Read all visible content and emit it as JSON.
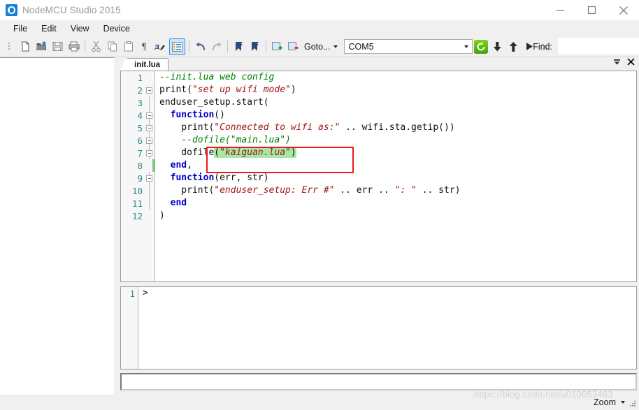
{
  "window": {
    "title": "NodeMCU Studio 2015",
    "app_icon": "nodemcu-logo-icon",
    "minimize_label": "minimize-icon",
    "maximize_label": "maximize-icon",
    "close_label": "close-icon"
  },
  "menubar": {
    "items": [
      {
        "label": "File"
      },
      {
        "label": "Edit"
      },
      {
        "label": "View"
      },
      {
        "label": "Device"
      }
    ]
  },
  "toolbar": {
    "buttons": [
      {
        "name": "new-file-icon",
        "glyph": "new"
      },
      {
        "name": "open-file-icon",
        "glyph": "open"
      },
      {
        "name": "save-file-icon",
        "glyph": "save"
      },
      {
        "name": "print-icon",
        "glyph": "print"
      },
      {
        "name": "cut-icon",
        "glyph": "cut"
      },
      {
        "name": "copy-icon",
        "glyph": "copy"
      },
      {
        "name": "paste-icon",
        "glyph": "paste"
      },
      {
        "name": "pilcrow-icon",
        "glyph": "pilcrow"
      },
      {
        "name": "syntax-icon",
        "glyph": "syntax"
      },
      {
        "name": "list-view-icon",
        "glyph": "list"
      },
      {
        "name": "undo-icon",
        "glyph": "undo"
      },
      {
        "name": "redo-icon",
        "glyph": "redo"
      },
      {
        "name": "bookmark-toggle-icon",
        "glyph": "bookmark"
      },
      {
        "name": "bookmark-next-icon",
        "glyph": "bookmark2"
      },
      {
        "name": "add-file-icon",
        "glyph": "addfile"
      },
      {
        "name": "remove-file-icon",
        "glyph": "removefile"
      }
    ],
    "goto_label": "Goto...",
    "port_value": "COM5",
    "refresh_button": "refresh-port-icon",
    "download_button": "download-icon",
    "upload_button": "upload-icon",
    "run_button": "run-icon",
    "stop_button": "stop-icon",
    "find_label": "Find:",
    "find_value": "",
    "find_placeholder": "",
    "accent_color": "#3c8ede",
    "green_color": "#5fb81b"
  },
  "tabs": {
    "items": [
      {
        "label": "init.lua",
        "active": true
      }
    ],
    "dropdown_icon": "tab-list-icon",
    "close_icon": "close-tab-icon"
  },
  "editor": {
    "language": "lua",
    "lines": [
      {
        "num": "1",
        "fold": false,
        "foldline": false,
        "changed": false,
        "tokens": [
          {
            "t": "--init.lua web config",
            "c": "k-com"
          }
        ]
      },
      {
        "num": "2",
        "fold": true,
        "foldline": false,
        "changed": false,
        "tokens": [
          {
            "t": "print(",
            "c": ""
          },
          {
            "t": "\"set up wifi mode\"",
            "c": "k-str"
          },
          {
            "t": ")",
            "c": ""
          }
        ]
      },
      {
        "num": "3",
        "fold": false,
        "foldline": true,
        "changed": false,
        "tokens": [
          {
            "t": "enduser_setup.start(",
            "c": ""
          }
        ]
      },
      {
        "num": "4",
        "fold": true,
        "foldline": true,
        "changed": false,
        "tokens": [
          {
            "t": "  ",
            "c": ""
          },
          {
            "t": "function",
            "c": "k-kw"
          },
          {
            "t": "()",
            "c": ""
          }
        ]
      },
      {
        "num": "5",
        "fold": true,
        "foldline": true,
        "changed": false,
        "tokens": [
          {
            "t": "    print(",
            "c": ""
          },
          {
            "t": "\"Connected to wifi as:\"",
            "c": "k-str"
          },
          {
            "t": " .. wifi.sta.getip())",
            "c": ""
          }
        ]
      },
      {
        "num": "6",
        "fold": true,
        "foldline": true,
        "changed": false,
        "tokens": [
          {
            "t": "    ",
            "c": ""
          },
          {
            "t": "--dofile(\"main.lua\")",
            "c": "k-com"
          }
        ]
      },
      {
        "num": "7",
        "fold": true,
        "foldline": true,
        "changed": false,
        "tokens": [
          {
            "t": "    dofile",
            "c": ""
          },
          {
            "t": "(",
            "c": "k-grn"
          },
          {
            "t": "\"kaiguan.lua\"",
            "c": "k-str k-grn"
          },
          {
            "t": ")",
            "c": "k-grn"
          }
        ]
      },
      {
        "num": "8",
        "fold": false,
        "foldline": false,
        "changed": true,
        "tokens": [
          {
            "t": "  ",
            "c": ""
          },
          {
            "t": "end",
            "c": "k-kw"
          },
          {
            "t": ",",
            "c": ""
          }
        ]
      },
      {
        "num": "9",
        "fold": true,
        "foldline": true,
        "changed": false,
        "tokens": [
          {
            "t": "  ",
            "c": ""
          },
          {
            "t": "function",
            "c": "k-kw"
          },
          {
            "t": "(err, str)",
            "c": ""
          }
        ]
      },
      {
        "num": "10",
        "fold": false,
        "foldline": true,
        "changed": false,
        "tokens": [
          {
            "t": "    print(",
            "c": ""
          },
          {
            "t": "\"enduser_setup: Err #\"",
            "c": "k-str"
          },
          {
            "t": " .. err .. ",
            "c": ""
          },
          {
            "t": "\": \"",
            "c": "k-str"
          },
          {
            "t": " .. str)",
            "c": ""
          }
        ]
      },
      {
        "num": "11",
        "fold": false,
        "foldline": true,
        "changed": false,
        "tokens": [
          {
            "t": "  ",
            "c": ""
          },
          {
            "t": "end",
            "c": "k-kw"
          }
        ]
      },
      {
        "num": "12",
        "fold": false,
        "foldline": false,
        "changed": false,
        "tokens": [
          {
            "t": ")",
            "c": ""
          }
        ]
      }
    ],
    "annotation": {
      "name": "red-highlight-box",
      "color": "#ee1c16",
      "covers_lines": "6-7"
    }
  },
  "console": {
    "lines": [
      {
        "num": "1",
        "text": ">"
      }
    ],
    "command_input_value": "",
    "command_input_placeholder": ""
  },
  "statusbar": {
    "zoom_label": "Zoom",
    "resize_grip": "resize-grip-icon"
  },
  "watermark": {
    "text": "https://blog.csdn.net/u010053463"
  }
}
